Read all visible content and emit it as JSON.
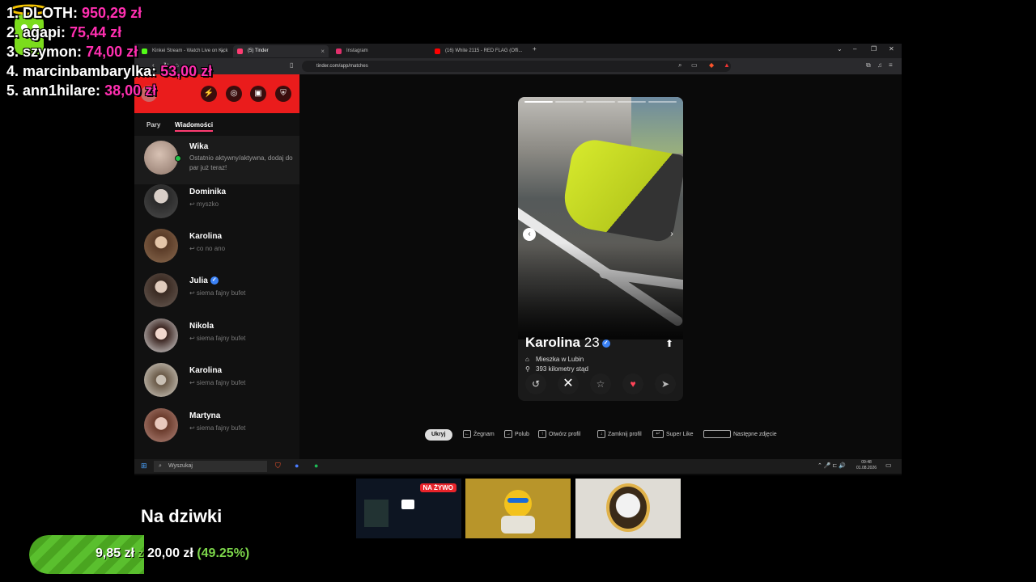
{
  "leaderboard": {
    "entries": [
      {
        "rank_name": "1. DLOTH:",
        "amount": "950,29 zł"
      },
      {
        "rank_name": "2. agapi:",
        "amount": "75,44 zł"
      },
      {
        "rank_name": "3. szymon:",
        "amount": "74,00 zł"
      },
      {
        "rank_name": "4. marcinbambarylka:",
        "amount": "53,00 zł"
      },
      {
        "rank_name": "5. ann1hilare:",
        "amount": "38,00 zł"
      }
    ]
  },
  "browser": {
    "tabs": [
      {
        "label": "Kinkei Stream - Watch Live on Kick",
        "favicon_color": "#53fc18"
      },
      {
        "label": "(5) Tinder",
        "favicon_color": "#fe3c72"
      },
      {
        "label": "Instagram",
        "favicon_color": "#e1306c"
      },
      {
        "label": "(16) White 2115 - RED FLAG (Offi...",
        "favicon_color": "#ff0000"
      }
    ],
    "new_tab": "+",
    "url": "tinder.com/app/matches",
    "window_controls": {
      "chevron": "⌄",
      "minimize": "–",
      "restore": "❐",
      "close": "✕"
    }
  },
  "tinder": {
    "tabs": {
      "matches": "Pary",
      "messages": "Wiadomości"
    },
    "header_icons": [
      "bolt-icon",
      "compass-icon",
      "briefcase-icon",
      "shield-icon"
    ],
    "conversations": [
      {
        "name": "Wika",
        "preview": "Ostatnio aktywny/aktywna, dodaj do par już teraz!",
        "online": true,
        "verified": false
      },
      {
        "name": "Dominika",
        "preview": "↩ myszko",
        "online": false,
        "verified": false
      },
      {
        "name": "Karolina",
        "preview": "↩ co no ano",
        "online": false,
        "verified": false
      },
      {
        "name": "Julia",
        "preview": "↩ siema fajny bufet",
        "online": false,
        "verified": true
      },
      {
        "name": "Nikola",
        "preview": "↩ siema fajny bufet",
        "online": false,
        "verified": false
      },
      {
        "name": "Karolina",
        "preview": "↩ siema fajny bufet",
        "online": false,
        "verified": false
      },
      {
        "name": "Martyna",
        "preview": "↩ siema fajny bufet",
        "online": false,
        "verified": false
      }
    ],
    "profile": {
      "name": "Karolina",
      "age": "23",
      "verified": true,
      "location": "Mieszka w Lubin",
      "distance": "393 kilometry stąd",
      "photo_count": 5,
      "current_photo": 1
    },
    "actions": [
      "rewind-icon",
      "nope-icon",
      "super-like-icon",
      "like-icon",
      "boost-icon"
    ],
    "shortcuts": {
      "hide": "Ukryj",
      "nope": "Żegnam",
      "like": "Polub",
      "open_profile": "Otwórz profil",
      "close_profile": "Zamknij profil",
      "super_like": "Super Like",
      "next_photo": "Następne zdjęcie"
    }
  },
  "taskbar": {
    "search_placeholder": "Wyszukaj",
    "time": "09:48",
    "date": "01.08.2026"
  },
  "overlay": {
    "live_badge": "NA ŻYWO",
    "goal": {
      "title": "Na dziwki",
      "current": "9,85 zł",
      "separator": "z",
      "target": "20,00 zł",
      "percent_label": "(49.25%)",
      "progress": 0.4925
    }
  },
  "colors": {
    "tinder_red": "#ea1c1c",
    "goal_green": "#5abf2e",
    "donation_pink": "#ff2fb0"
  }
}
